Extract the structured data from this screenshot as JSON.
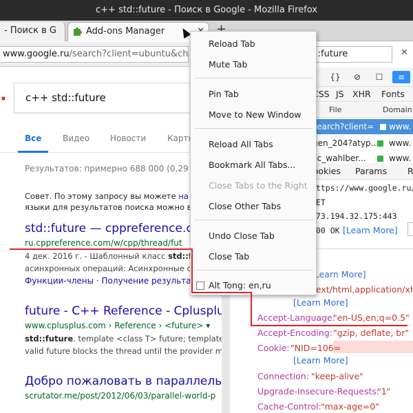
{
  "window": {
    "title": "c++ std::future - Поиск в Google - Mozilla Firefox"
  },
  "tabs": [
    {
      "label": "- Поиск в G"
    },
    {
      "label": "Add-ons Manager"
    }
  ],
  "urlbar": {
    "host": "www.google.ru",
    "path": "/search?client=ubuntu&chann"
  },
  "google": {
    "query": "c++ std::future",
    "tabs": [
      "Все",
      "Видео",
      "Новости",
      "Карти"
    ],
    "result_count": "Результатов: примерно 688 000 (0,29 се",
    "hint_line1_prefix": "Совет. По этому запросу вы можете ",
    "hint_line1_link": "на",
    "hint_line2": "языки для результатов поиска можно в",
    "results": [
      {
        "title": "std::future — cppreference.co",
        "url": "ru.cppreference.com/w/cpp/thread/fut",
        "snippet1_prefix": "4 дек. 2016 г. - Шаблонный класс ",
        "snippet1_bold": "std::fu",
        "snippet2": "асинхронных операций: Асинхронные о",
        "links": "Функции-члены · Получение результата"
      },
      {
        "title": "future - C++ Reference - Cplusplus.",
        "url": "www.cplusplus.com › Reference › <future> ▾",
        "snippet1_bold": "std::future",
        "snippet1_rest": ". template <class T> future; template <",
        "snippet2": "valid future blocks the thread until the provider ma"
      },
      {
        "title": "Добро пожаловать в параллельны",
        "url": "scrutator.me/post/2012/06/03/parallel-world-p"
      }
    ]
  },
  "devtools": {
    "url_text": "d::future",
    "toolbar_icons": [
      "{}",
      "⊘",
      "☐",
      "≡"
    ],
    "filters": [
      "CSS",
      "JS",
      "XHR",
      "Fonts"
    ],
    "columns": {
      "file": "File",
      "domain": "Domain"
    },
    "rows": [
      {
        "file": "search?client=",
        "domain": "www."
      },
      {
        "file": "gen_204?atyp...",
        "domain": "www."
      },
      {
        "file": "lic_wahlber...",
        "domain": "www."
      }
    ],
    "subtabs": [
      "Cookies",
      "Params",
      "R"
    ],
    "req_url": "https://www.google.ru/se",
    "method": "GET",
    "address": "173.194.32.175:443",
    "status": "200 OK",
    "learn_more": "[Learn More]",
    "headers": [
      {
        "key": "",
        "value": "text/html,application/xhtml+"
      },
      {
        "key": "Accept-Language:",
        "value": "\"en-US,en;q=0.5\""
      },
      {
        "key": "Accept-Encoding:",
        "value": "\"gzip, deflate, br\""
      },
      {
        "key": "Cookie:",
        "value": "\"NID=106="
      },
      {
        "key": "Connection:",
        "value": "\"keep-alive\""
      },
      {
        "key": "Upgrade-Insecure-Requests:",
        "value": "\"1\""
      },
      {
        "key": "Cache-Control:",
        "value": "\"max-age=0\""
      }
    ]
  },
  "context_menu": {
    "items": [
      {
        "label": "Reload Tab",
        "disabled": false
      },
      {
        "label": "Mute Tab",
        "disabled": false
      },
      {
        "label": "Pin Tab",
        "disabled": false
      },
      {
        "label": "Move to New Window",
        "disabled": false
      },
      {
        "label": "Reload All Tabs",
        "disabled": false
      },
      {
        "label": "Bookmark All Tabs...",
        "disabled": false
      },
      {
        "label": "Close Tabs to the Right",
        "disabled": true
      },
      {
        "label": "Close Other Tabs",
        "disabled": false
      },
      {
        "label": "Undo Close Tab",
        "disabled": false
      },
      {
        "label": "Close Tab",
        "disabled": false
      }
    ],
    "checkbox_label": "Alt Tong: en,ru"
  },
  "colors": {
    "accent_blue": "#1a73e8",
    "link": "#1a0dab",
    "url_green": "#006621",
    "annotation_red": "#d8232a",
    "header_key": "#b23aa5",
    "header_value": "#c0392b"
  }
}
